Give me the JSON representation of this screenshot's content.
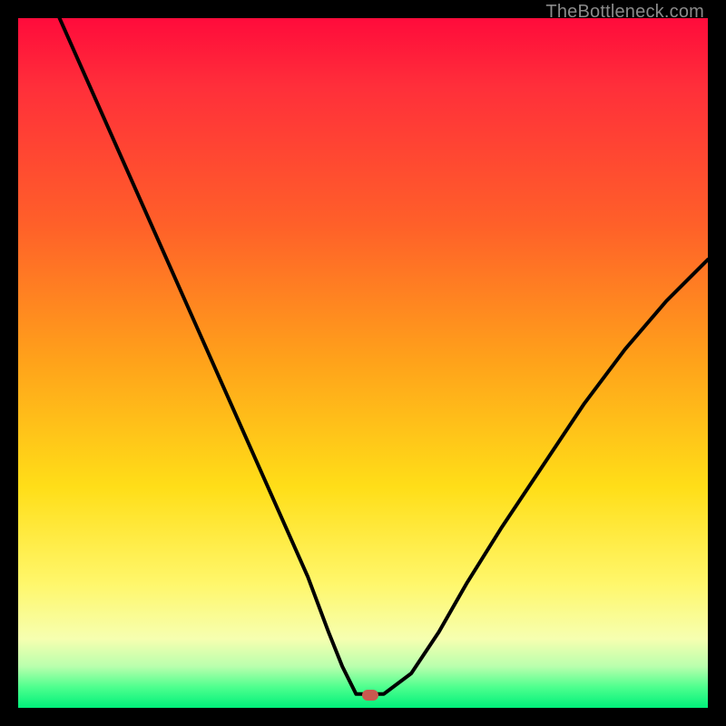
{
  "watermark": "TheBottleneck.com",
  "marker": {
    "cx_pct": 51.0,
    "cy_pct": 98.2
  },
  "chart_data": {
    "type": "line",
    "title": "",
    "xlabel": "",
    "ylabel": "",
    "xlim": [
      0,
      100
    ],
    "ylim": [
      0,
      100
    ],
    "grid": false,
    "legend": false,
    "series": [
      {
        "name": "bottleneck-curve",
        "x": [
          6,
          10,
          14,
          18,
          22,
          26,
          30,
          34,
          38,
          42,
          45,
          47,
          49,
          51,
          53,
          57,
          61,
          65,
          70,
          76,
          82,
          88,
          94,
          100
        ],
        "y": [
          100,
          91,
          82,
          73,
          64,
          55,
          46,
          37,
          28,
          19,
          11,
          6,
          2,
          2,
          2,
          5,
          11,
          18,
          26,
          35,
          44,
          52,
          59,
          65
        ]
      }
    ],
    "annotations": [
      {
        "type": "marker",
        "x": 51,
        "y": 1.8,
        "label": "optimal-point"
      }
    ],
    "background_gradient": {
      "direction": "vertical",
      "stops": [
        {
          "pct": 0,
          "color": "#ff0b3b"
        },
        {
          "pct": 30,
          "color": "#ff6029"
        },
        {
          "pct": 50,
          "color": "#ffa31a"
        },
        {
          "pct": 70,
          "color": "#ffde18"
        },
        {
          "pct": 90,
          "color": "#f6ffb0"
        },
        {
          "pct": 100,
          "color": "#00f07a"
        }
      ]
    }
  }
}
